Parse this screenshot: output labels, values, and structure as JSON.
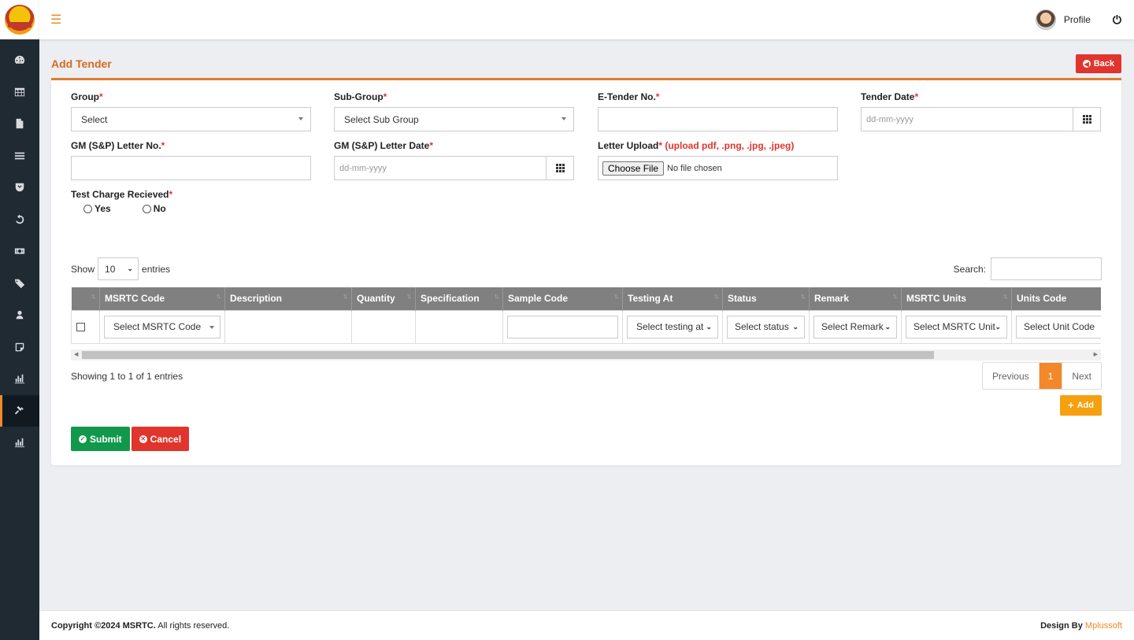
{
  "app": {
    "title": "MSRTC"
  },
  "topbar": {
    "profile_label": "Profile"
  },
  "sidebar": {
    "items": [
      {
        "icon": "dashboard-icon"
      },
      {
        "icon": "table-icon"
      },
      {
        "icon": "file-icon"
      },
      {
        "icon": "list-icon"
      },
      {
        "icon": "shield-icon"
      },
      {
        "icon": "refresh-icon"
      },
      {
        "icon": "money-icon"
      },
      {
        "icon": "tag-icon"
      },
      {
        "icon": "user-icon"
      },
      {
        "icon": "note-icon"
      },
      {
        "icon": "bar-chart-icon"
      },
      {
        "icon": "gavel-icon",
        "active": true
      },
      {
        "icon": "bar-chart-icon"
      }
    ]
  },
  "page": {
    "title": "Add Tender",
    "back_label": "Back"
  },
  "form": {
    "group": {
      "label": "Group",
      "value": "Select"
    },
    "sub_group": {
      "label": "Sub-Group",
      "value": "Select Sub Group"
    },
    "e_tender_no": {
      "label": "E-Tender No.",
      "value": ""
    },
    "tender_date": {
      "label": "Tender Date",
      "placeholder": "dd-mm-yyyy"
    },
    "gm_letter_no": {
      "label": "GM (S&P) Letter No.",
      "value": ""
    },
    "gm_letter_date": {
      "label": "GM (S&P) Letter Date",
      "placeholder": "dd-mm-yyyy"
    },
    "letter_upload": {
      "label": "Letter Upload",
      "hint": "(upload pdf, .png, .jpg, .jpeg)",
      "button": "Choose File",
      "status": "No file chosen"
    },
    "test_charge": {
      "label": "Test Charge Recieved",
      "options": [
        "Yes",
        "No"
      ]
    },
    "required_mark": "*"
  },
  "table": {
    "show_label": "Show",
    "entries_value": "10",
    "entries_label": "entries",
    "search_label": "Search:",
    "columns": [
      "MSRTC Code",
      "Description",
      "Quantity",
      "Specification",
      "Sample Code",
      "Testing At",
      "Status",
      "Remark",
      "MSRTC Units",
      "Units Code"
    ],
    "row": {
      "msrtc_code": "Select MSRTC Code",
      "testing_at": "Select testing at",
      "status": "Select status",
      "remark": "Select Remark",
      "msrtc_unit": "Select MSRTC Unit",
      "unit_code": "Select Unit Code"
    },
    "showing_text": "Showing 1 to 1 of 1 entries",
    "pager": {
      "prev": "Previous",
      "current": "1",
      "next": "Next"
    },
    "add_label": "Add"
  },
  "actions": {
    "submit": "Submit",
    "cancel": "Cancel"
  },
  "footer": {
    "copyright_prefix": "Copyright ©2024 MSRTC.",
    "copyright_suffix": " All rights reserved.",
    "design_by": "Design By ",
    "brand": "Mplussoft"
  },
  "colors": {
    "accent": "#f1882a",
    "danger": "#e0352d",
    "success": "#11984b",
    "warning": "#f5a00f",
    "sidebar": "#1f2a33"
  }
}
